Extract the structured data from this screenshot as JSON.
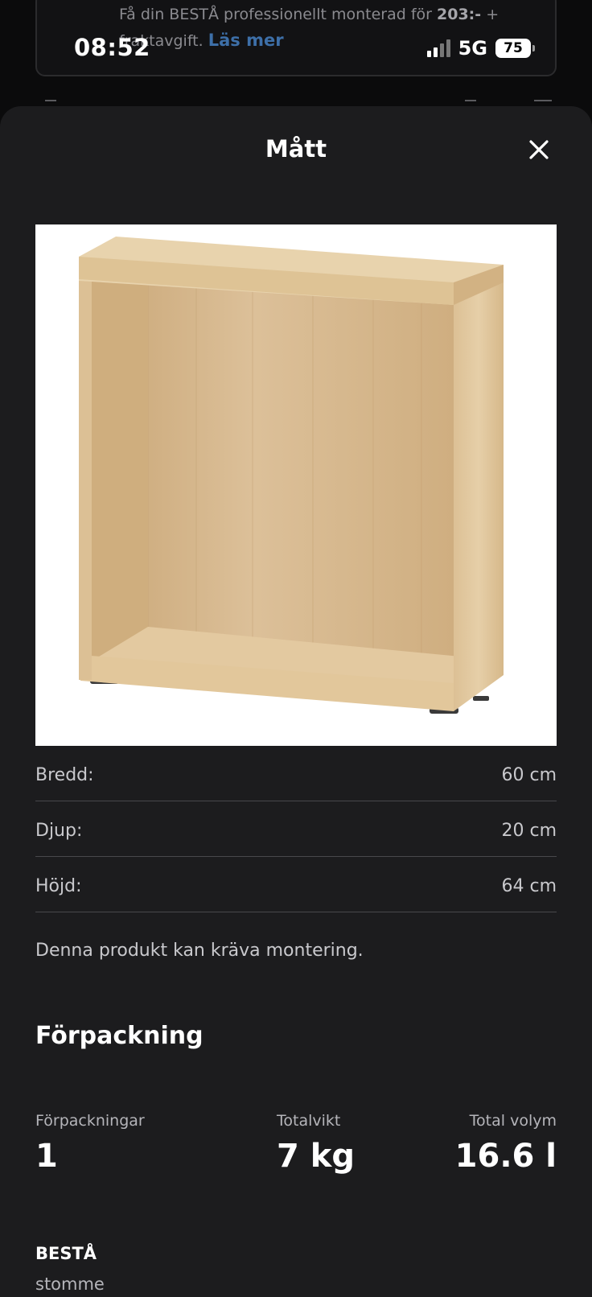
{
  "status_bar": {
    "time": "08:52",
    "network": "5G",
    "battery": "75"
  },
  "background": {
    "text_prefix": "Få din BESTÅ professionellt monterad för ",
    "price": "203:-",
    "text_suffix": " + fraktavgift. ",
    "link": "Läs mer"
  },
  "sheet": {
    "title": "Mått",
    "close_icon": "close-icon",
    "image_alt": "BESTÅ stomme",
    "dimensions": [
      {
        "label": "Bredd:",
        "value": "60 cm"
      },
      {
        "label": "Djup:",
        "value": "20 cm"
      },
      {
        "label": "Höjd:",
        "value": "64 cm"
      }
    ],
    "assembly_note": "Denna produkt kan kräva montering.",
    "packaging": {
      "heading": "Förpackning",
      "stats": [
        {
          "label": "Förpackningar",
          "value": "1"
        },
        {
          "label": "Totalvikt",
          "value": "7 kg"
        },
        {
          "label": "Total volym",
          "value": "16.6 l"
        }
      ]
    },
    "product": {
      "name": "BESTÅ",
      "description": "stomme"
    }
  },
  "colors": {
    "sheet_bg": "#1c1c1e",
    "link": "#3d6fa8",
    "divider": "#48484c"
  }
}
